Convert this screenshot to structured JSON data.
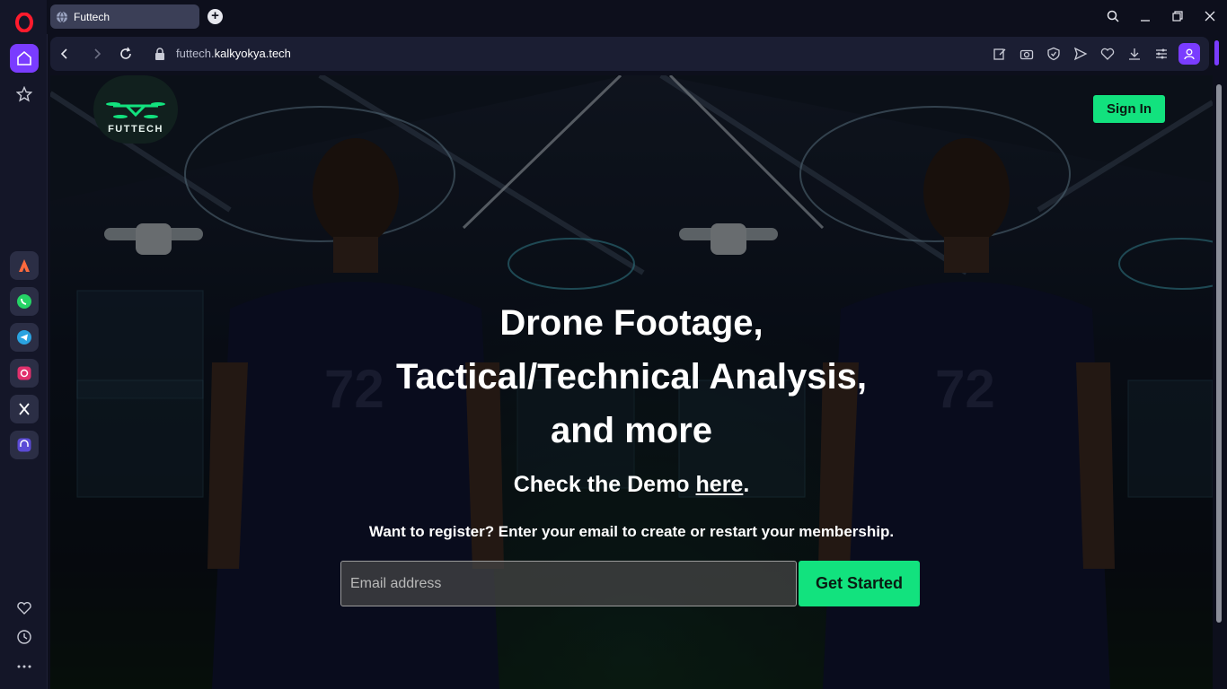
{
  "browser": {
    "tab_title": "Futtech",
    "new_tab": "+",
    "url_prefix": "futtech.",
    "url_domain": "kalkyokya.tech"
  },
  "sidebar": {
    "items": [
      "home-icon",
      "star-icon",
      "aria-icon",
      "whatsapp-icon",
      "telegram-icon",
      "instagram-icon",
      "x-icon",
      "music-player-icon",
      "heart-icon",
      "history-icon",
      "more-icon"
    ]
  },
  "page": {
    "logo_text": "FUTTECH",
    "sign_in": "Sign In",
    "headline": [
      "Drone Footage,",
      "Tactical/Technical Analysis,",
      "and more"
    ],
    "demo_prefix": "Check the Demo ",
    "demo_link": "here",
    "demo_suffix": ".",
    "register_text": "Want to register? Enter your email to create or restart your membership.",
    "email_placeholder": "Email address",
    "get_started": "Get Started",
    "jersey_number": "72"
  },
  "colors": {
    "accent": "#12e27e",
    "opera_purple": "#7a3cff"
  }
}
